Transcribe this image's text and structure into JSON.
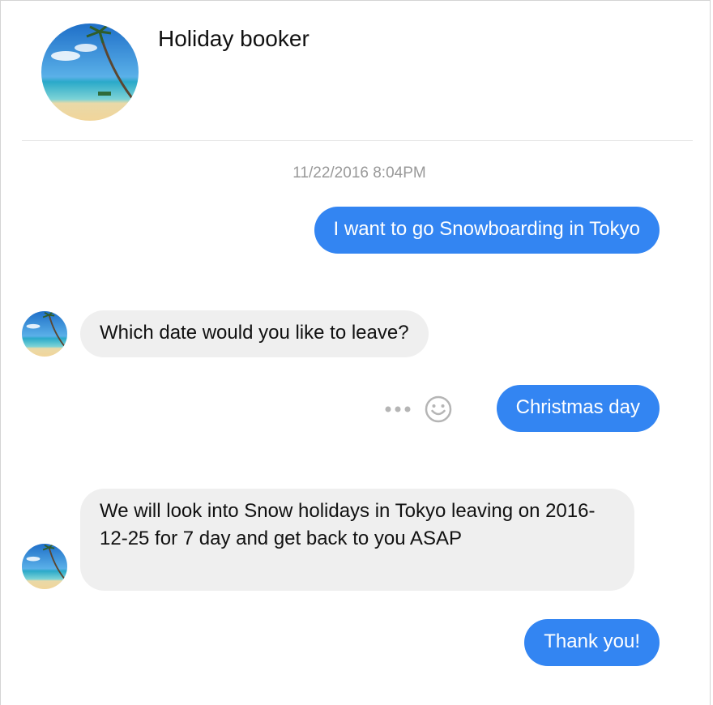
{
  "header": {
    "title": "Holiday booker",
    "avatar_icon": "beach-palm-avatar-icon"
  },
  "timestamp": "11/22/2016 8:04PM",
  "messages": [
    {
      "from": "user",
      "text": "I want to go Snowboarding in Tokyo"
    },
    {
      "from": "bot",
      "text": "Which date would you like to leave?"
    },
    {
      "from": "user",
      "text": "Christmas day"
    },
    {
      "from": "bot",
      "text": "We will look into Snow holidays in Tokyo leaving on 2016-12-25 for 7 day and get back to you ASAP"
    },
    {
      "from": "user",
      "text": "Thank you!"
    }
  ],
  "icons": {
    "more": "more-dots-icon",
    "reaction": "smiley-face-icon"
  },
  "colors": {
    "outgoing_bubble": "#3385f2",
    "incoming_bubble": "#efefef",
    "timestamp_text": "#999999"
  }
}
